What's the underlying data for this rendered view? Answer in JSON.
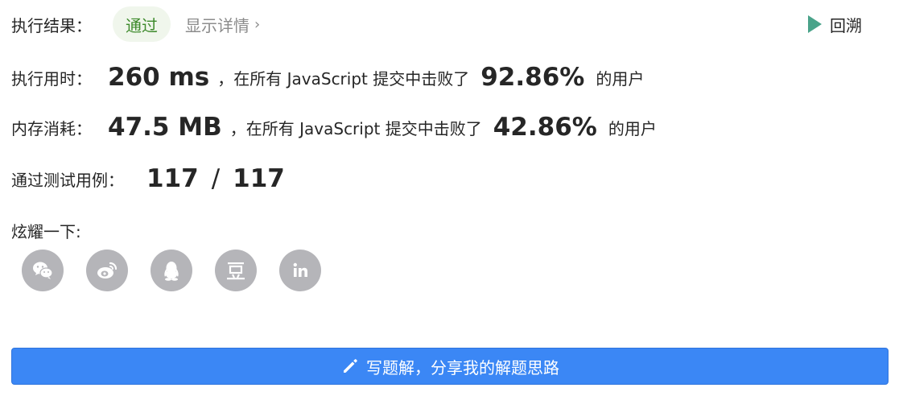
{
  "result": {
    "label": "执行结果：",
    "status": "通过",
    "details_link": "显示详情",
    "details_chevron": "›",
    "replay_label": "回溯",
    "status_color": "#3d8a2b"
  },
  "runtime": {
    "label": "执行用时：",
    "value": "260 ms",
    "comparison_text": "，在所有 JavaScript 提交中击败了",
    "percent": "92.86%",
    "suffix": "的用户"
  },
  "memory": {
    "label": "内存消耗：",
    "value": "47.5 MB",
    "comparison_text": "，在所有 JavaScript 提交中击败了",
    "percent": "42.86%",
    "suffix": "的用户"
  },
  "tests": {
    "label": "通过测试用例：",
    "passed": "117",
    "separator": "/",
    "total": "117"
  },
  "share": {
    "label": "炫耀一下:",
    "icons": [
      "wechat-icon",
      "weibo-icon",
      "qq-icon",
      "douban-icon",
      "linkedin-icon"
    ]
  },
  "write_solution": {
    "label": "写题解，分享我的解题思路",
    "color": "#3b87f5"
  }
}
